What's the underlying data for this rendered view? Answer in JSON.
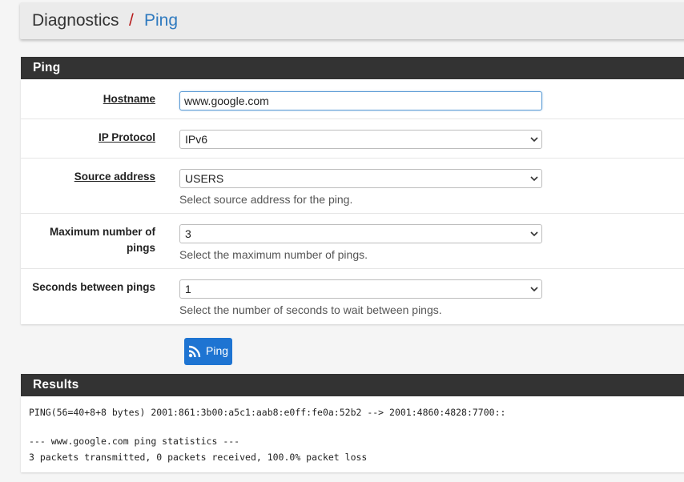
{
  "breadcrumb": {
    "root": "Diagnostics",
    "separator": "/",
    "current": "Ping"
  },
  "ping_panel": {
    "title": "Ping",
    "fields": [
      {
        "label": "Hostname",
        "value": "www.google.com",
        "help": ""
      },
      {
        "label": "IP Protocol",
        "value": "IPv6",
        "help": ""
      },
      {
        "label": "Source address",
        "value": "USERS",
        "help": "Select source address for the ping."
      },
      {
        "label_line1": "Maximum number of",
        "label_line2": "pings",
        "value": "3",
        "help": "Select the maximum number of pings."
      },
      {
        "label": "Seconds between pings",
        "value": "1",
        "help": "Select the number of seconds to wait between pings."
      }
    ],
    "button_label": "Ping",
    "button_icon": "rss-icon"
  },
  "results_panel": {
    "title": "Results",
    "lines": [
      "PING(56=40+8+8 bytes) 2001:861:3b00:a5c1:aab8:e0ff:fe0a:52b2 --> 2001:4860:4828:7700::",
      "--- www.google.com ping statistics ---",
      "3 packets transmitted, 0 packets received, 100.0% packet loss"
    ]
  },
  "colors": {
    "panel_header": "#333333",
    "breadcrumb_separator": "#b71c1c",
    "breadcrumb_current": "#2f7abf",
    "button": "#1e74d2"
  }
}
